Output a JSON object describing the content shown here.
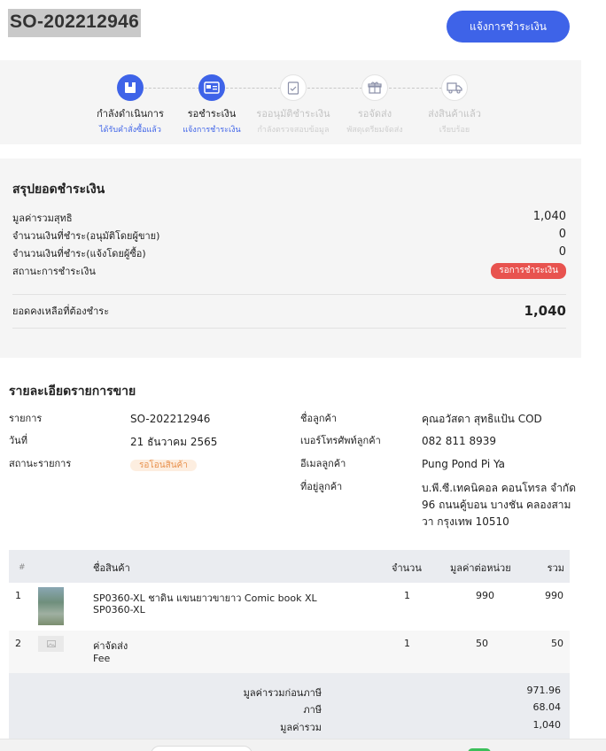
{
  "header": {
    "order_id": "SO-202212946",
    "notify_button": "แจ้งการชำระเงิน"
  },
  "steps": [
    {
      "title": "กำลังดำเนินการ",
      "subtitle": "ได้รับคำสั่งซื้อแล้ว",
      "icon": "box-icon",
      "state": "active"
    },
    {
      "title": "รอชำระเงิน",
      "subtitle": "แจ้งการชำระเงิน",
      "icon": "payment-card-icon",
      "state": "active"
    },
    {
      "title": "รออนุมัติชำระเงิน",
      "subtitle": "กำลังตรวจสอบข้อมูล",
      "icon": "clipboard-check-icon",
      "state": "inactive"
    },
    {
      "title": "รอจัดส่ง",
      "subtitle": "พัสดุเตรียมจัดส่ง",
      "icon": "gift-icon",
      "state": "inactive"
    },
    {
      "title": "ส่งสินค้าแล้ว",
      "subtitle": "เรียบร้อย",
      "icon": "truck-icon",
      "state": "inactive"
    }
  ],
  "payment": {
    "title": "สรุปยอดชำระเงิน",
    "net_total_label": "มูลค่ารวมสุทธิ",
    "net_total": "1,040",
    "paid_approved_label": "จำนวนเงินที่ชำระ(อนุมัติโดยผู้ขาย)",
    "paid_approved": "0",
    "paid_reported_label": "จำนวนเงินที่ชำระ(แจ้งโดยผู้ซื้อ)",
    "paid_reported": "0",
    "status_label": "สถานะการชำระเงิน",
    "status": "รอการชำระเงิน",
    "remaining_label": "ยอดคงเหลือที่ต้องชำระ",
    "remaining": "1,040"
  },
  "details": {
    "title": "รายละเอียดรายการขาย",
    "item_label": "รายการ",
    "item": "SO-202212946",
    "date_label": "วันที่",
    "date": "21 ธันวาคม 2565",
    "status_label": "สถานะรายการ",
    "status": "รอโอนสินค้า",
    "customer_label": "ชื่อลูกค้า",
    "customer": "คุณอวัสดา สุทธิแป้น COD",
    "phone_label": "เบอร์โทรศัพท์ลูกค้า",
    "phone": "082 811 8939",
    "email_label": "อีเมลลูกค้า",
    "email": "Pung Pond Pi Ya",
    "address_label": "ที่อยู่ลูกค้า",
    "address_lines": [
      "บ.พี.ซี.เทคนิคอล คอนโทรล จำกัด",
      "96 ถนนคู้บอน บางชัน คลองสาม",
      "วา กรุงเทพ 10510"
    ]
  },
  "table": {
    "headers": {
      "num": "#",
      "name": "ชื่อสินค้า",
      "qty": "จำนวน",
      "unit_price": "มูลค่าต่อหน่วย",
      "total": "รวม"
    },
    "rows": [
      {
        "num": "1",
        "name": "SP0360-XL ชาดิน แขนยาวขายาว Comic book XL",
        "sku": "SP0360-XL",
        "qty": "1",
        "unit_price": "990",
        "total": "990"
      },
      {
        "num": "2",
        "name": "ค่าจัดส่ง",
        "sku": "Fee",
        "qty": "1",
        "unit_price": "50",
        "total": "50"
      }
    ],
    "summary": {
      "pre_tax_label": "มูลค่ารวมก่อนภาษี",
      "pre_tax": "971.96",
      "tax_label": "ภาษี",
      "tax": "68.04",
      "total_label": "มูลค่ารวม",
      "total": "1,040"
    }
  }
}
